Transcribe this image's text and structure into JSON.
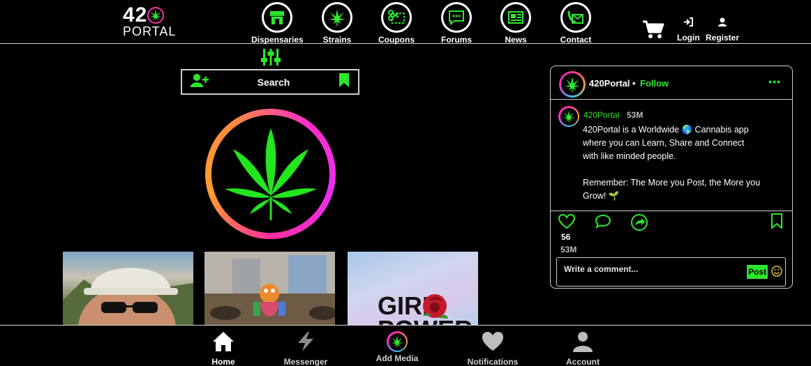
{
  "logo": {
    "line1": "42",
    "line2": "PORTAL"
  },
  "nav": {
    "items": [
      {
        "label": "Dispensaries",
        "icon": "storefront-icon"
      },
      {
        "label": "Strains",
        "icon": "cannabis-leaf-icon"
      },
      {
        "label": "Coupons",
        "icon": "coupon-scissors-icon"
      },
      {
        "label": "Forums",
        "icon": "chat-bubble-icon"
      },
      {
        "label": "News",
        "icon": "newspaper-icon"
      },
      {
        "label": "Contact",
        "icon": "phone-envelope-icon"
      }
    ],
    "cart_icon": "cart-icon",
    "login_label": "Login",
    "register_label": "Register"
  },
  "search": {
    "label": "Search",
    "add_friend_icon": "add-user-icon",
    "bookmark_icon": "bookmark-icon",
    "filter_icon": "filter-sliders-icon"
  },
  "post": {
    "account": "420Portal",
    "follow_label": "Follow",
    "separator": "•",
    "more_icon": "more-dots-icon",
    "caption_user": "420Portal",
    "caption_time": "53M",
    "caption_lines": [
      "420Portal is a Worldwide 🌎 Cannabis app where you can Learn, Share and Connect with like minded people.",
      "Remember: The More you Post, the More you Grow! 🌱"
    ],
    "likes": "56",
    "time": "53M",
    "comment_placeholder": "Write a comment...",
    "post_button": "Post"
  },
  "thumbnails": [
    {
      "alt": "selfie-photo"
    },
    {
      "alt": "party-photo"
    },
    {
      "alt": "girl-power-photo",
      "text_line1": "GIRL",
      "text_line2": "POWER"
    }
  ],
  "bottom_nav": [
    {
      "label": "Home",
      "icon": "home-icon"
    },
    {
      "label": "Messenger",
      "icon": "lightning-icon"
    },
    {
      "label": "Add Media",
      "icon": "cannabis-leaf-icon"
    },
    {
      "label": "Notifications",
      "icon": "heart-icon"
    },
    {
      "label": "Account",
      "icon": "user-icon"
    }
  ],
  "colors": {
    "accent": "#2ee62e",
    "background": "#000000",
    "ring_pink": "#ff2ea0",
    "ring_orange": "#ff9e2e"
  }
}
